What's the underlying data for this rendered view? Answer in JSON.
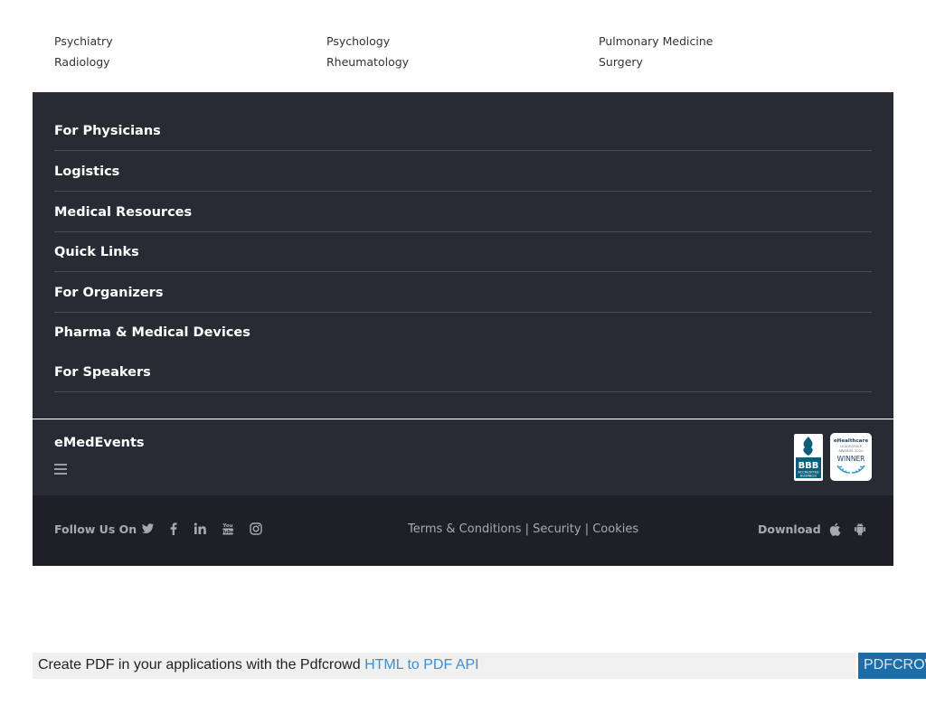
{
  "specialties": [
    [
      "Psychiatry",
      "Psychology",
      "Pulmonary Medicine"
    ],
    [
      "Radiology",
      "Rheumatology",
      "Surgery"
    ]
  ],
  "footer_nav": [
    "For Physicians",
    "Logistics",
    "Medical Resources",
    "Quick Links",
    "For Organizers",
    "Pharma & Medical Devices",
    "For Speakers"
  ],
  "brand": {
    "name": "eMedEvents",
    "bbb_badge": {
      "line1": "BBB",
      "line2": "ACCREDITED",
      "line3": "BUSINESS"
    },
    "ehc_badge": {
      "title": "eHealthcare",
      "line1": "LEADERSHIP",
      "line2": "AWARDS 2020",
      "line3": "WINNER"
    }
  },
  "bottom_bar": {
    "follow_label": "Follow Us On",
    "social_icons": [
      "twitter-icon",
      "facebook-icon",
      "linkedin-icon",
      "youtube-icon",
      "instagram-icon"
    ],
    "legal": {
      "terms": "Terms & Conditions",
      "security": "Security",
      "cookies": "Cookies",
      "separator": "|"
    },
    "download_label": "Download",
    "app_icons": [
      "apple-icon",
      "android-icon"
    ]
  },
  "pdf_banner": {
    "text": "Create PDF in your applications with the Pdfcrowd",
    "link": "HTML to PDF API",
    "brand": "PDFCROWD"
  },
  "colors": {
    "footer_bg": "#282b34",
    "bottom_bg": "#1f2027",
    "muted_text": "#a8aab2",
    "banner_link": "#3e8fd1",
    "banner_brand_bg": "#1d6ea8"
  }
}
